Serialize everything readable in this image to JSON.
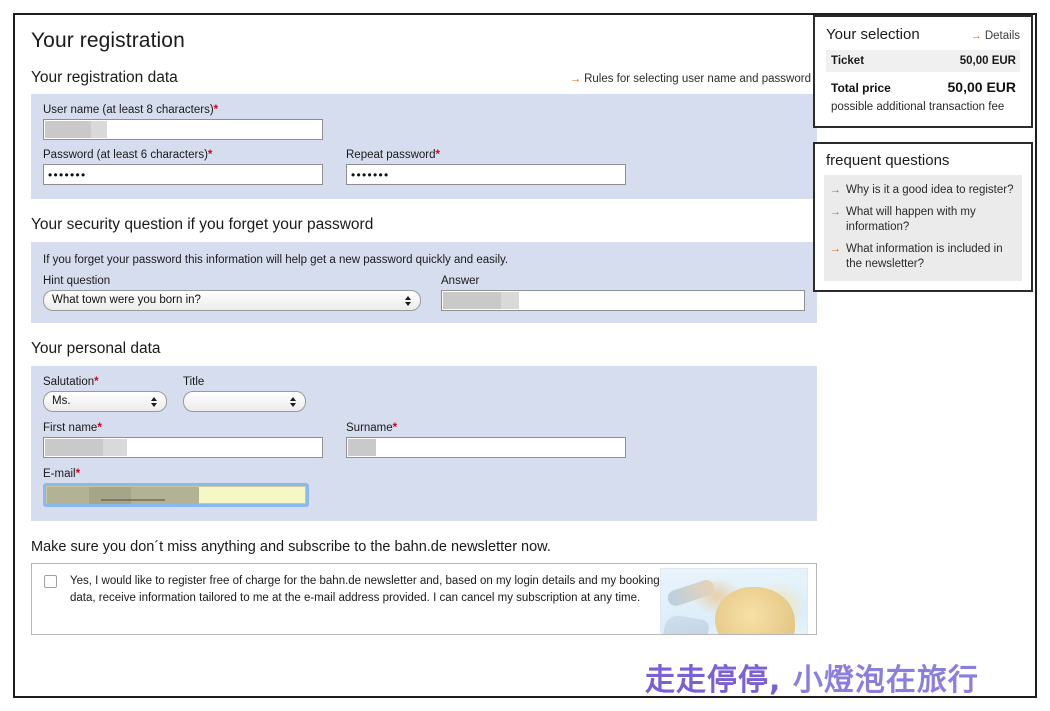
{
  "page": {
    "title": "Your registration",
    "watermark_part1": "走走停停,",
    "watermark_part2": "小燈泡在旅行"
  },
  "registration_data": {
    "section_title": "Your registration data",
    "rules_link": "Rules for selecting user name and password",
    "arrow": "→",
    "username_label": "User name (at least 8 characters)",
    "username_value": "",
    "password_label": "Password (at least 6 characters)",
    "password_value": "•••••••",
    "repeat_password_label": "Repeat password",
    "repeat_password_value": "•••••••",
    "required_marker": "*"
  },
  "security_question": {
    "section_title": "Your security question if you forget your password",
    "note": "If you forget your password this information will help get a new password quickly and easily.",
    "hint_label": "Hint question",
    "hint_selected": "What town were you born in?",
    "hint_options": [
      "What town were you born in?"
    ],
    "answer_label": "Answer",
    "answer_value": ""
  },
  "personal_data": {
    "section_title": "Your personal data",
    "salutation_label": "Salutation",
    "salutation_selected": "Ms.",
    "salutation_options": [
      "Ms."
    ],
    "title_label": "Title",
    "title_selected": "",
    "title_options": [
      ""
    ],
    "first_name_label": "First name",
    "first_name_value": "",
    "surname_label": "Surname",
    "surname_value": "",
    "email_label": "E-mail",
    "email_value": "",
    "required_marker": "*"
  },
  "newsletter": {
    "heading": "Make sure you don´t miss anything and subscribe to the bahn.de newsletter now.",
    "consent_text": "Yes, I would like to register free of charge for the bahn.de newsletter and, based on my login details and my booking data, receive information tailored to me at the e-mail address provided. I can cancel my subscription at any time.",
    "checked": false
  },
  "selection_panel": {
    "title": "Your selection",
    "details_link": "Details",
    "arrow": "→",
    "ticket_label": "Ticket",
    "ticket_price": "50,00 EUR",
    "total_label": "Total price",
    "total_price": "50,00 EUR",
    "fee_note": "possible additional transaction fee"
  },
  "faq_panel": {
    "title": "frequent questions",
    "arrow": "→",
    "items": [
      "Why is it a good idea to register?",
      "What will happen with my information?",
      "What information is included in the newsletter?"
    ]
  },
  "colors": {
    "panel_blue": "#d6ddee",
    "accent_orange": "#e1590c",
    "required_red": "#d0021b",
    "autofill_yellow": "#f7f6c6",
    "focus_blue": "#7ab4ef",
    "watermark_purple": "#7a5fd6"
  }
}
